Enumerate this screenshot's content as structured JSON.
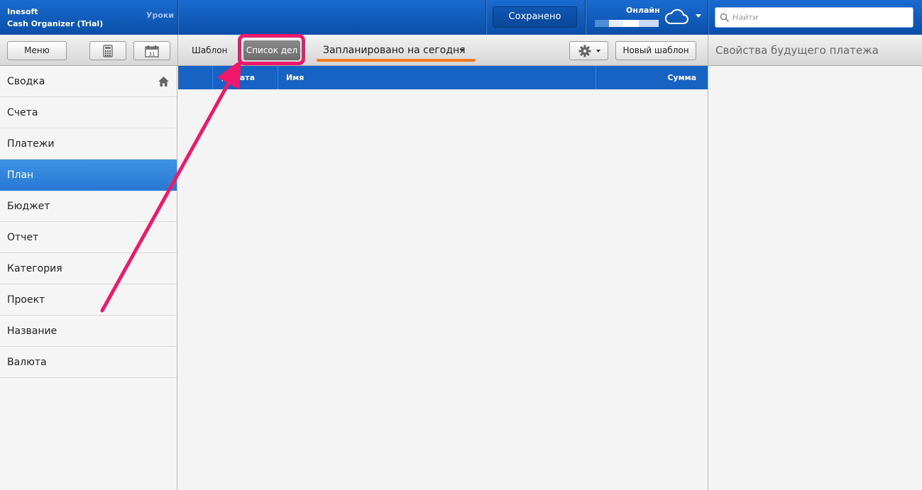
{
  "header": {
    "brand_line1": "Inesoft",
    "brand_line2": "Cash Organizer (Trial)",
    "lessons_label": "Уроки",
    "saved_label": "Сохранено",
    "online_label": "Онлайн",
    "search_placeholder": "Найти"
  },
  "toolbar": {
    "menu_label": "Меню",
    "calculator_icon": "calculator-icon",
    "calendar_icon": "calendar-icon",
    "calendar_day": "31",
    "template_tab": "Шаблон",
    "todo_tab": "Список дел",
    "planned_filter": "Запланировано на сегодня",
    "settings_icon": "gear-icon",
    "new_template_label": "Новый шаблон",
    "properties_title": "Свойства будущего платежа"
  },
  "sidebar": {
    "items": [
      {
        "label": "Сводка",
        "active": false
      },
      {
        "label": "Счета",
        "active": false
      },
      {
        "label": "Платежи",
        "active": false
      },
      {
        "label": "План",
        "active": true
      },
      {
        "label": "Бюджет",
        "active": false
      },
      {
        "label": "Отчет",
        "active": false
      },
      {
        "label": "Категория",
        "active": false
      },
      {
        "label": "Проект",
        "active": false
      },
      {
        "label": "Название",
        "active": false
      },
      {
        "label": "Валюта",
        "active": false
      }
    ]
  },
  "table": {
    "columns": {
      "date": "д. дата",
      "name": "Имя",
      "sum": "Сумма"
    },
    "rows": []
  },
  "colors": {
    "header_blue": "#0a4fa8",
    "active_nav": "#2879d4",
    "highlight_pink": "#f0186a",
    "underline_orange": "#f47a1f"
  }
}
